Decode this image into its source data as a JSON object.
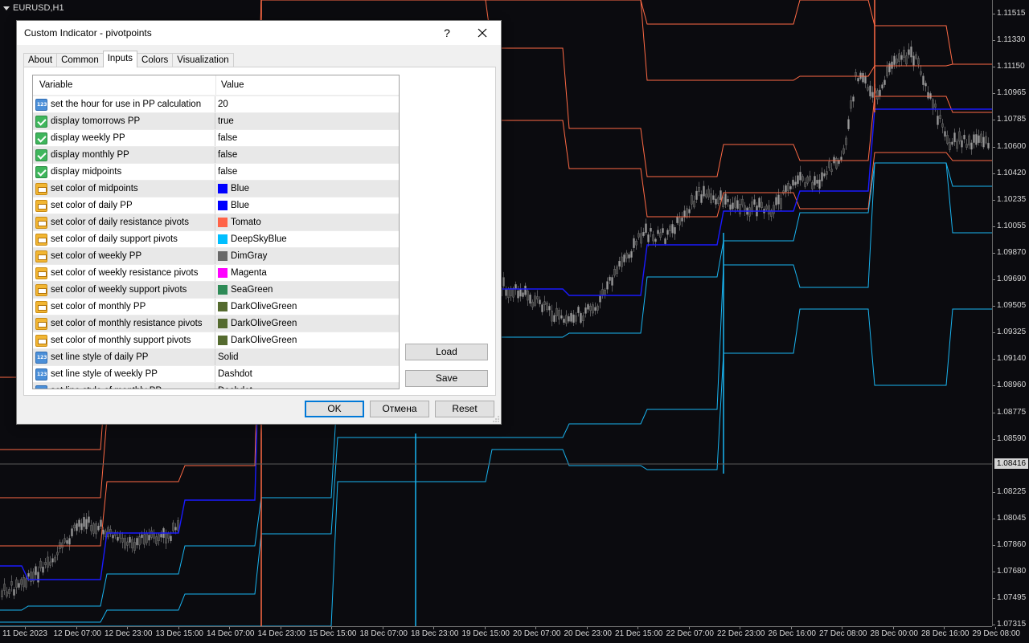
{
  "chart": {
    "symbol_label": "EURUSD,H1",
    "current_price": "1.08416",
    "price_labels": [
      "1.11515",
      "1.11330",
      "1.11150",
      "1.10965",
      "1.10785",
      "1.10600",
      "1.10420",
      "1.10235",
      "1.10055",
      "1.09870",
      "1.09690",
      "1.09505",
      "1.09325",
      "1.09140",
      "1.08960",
      "1.08775",
      "1.08590",
      "1.08416",
      "1.08225",
      "1.08045",
      "1.07860",
      "1.07680",
      "1.07495",
      "1.07315"
    ],
    "time_labels": [
      "11 Dec 2023",
      "12 Dec 07:00",
      "12 Dec 23:00",
      "13 Dec 15:00",
      "14 Dec 07:00",
      "14 Dec 23:00",
      "15 Dec 15:00",
      "18 Dec 07:00",
      "18 Dec 23:00",
      "19 Dec 15:00",
      "20 Dec 07:00",
      "20 Dec 23:00",
      "21 Dec 15:00",
      "22 Dec 07:00",
      "22 Dec 23:00",
      "26 Dec 16:00",
      "27 Dec 08:00",
      "28 Dec 00:00",
      "28 Dec 16:00",
      "29 Dec 08:00"
    ],
    "colors": {
      "background": "#0b0b0f",
      "resistance": "#ff6a45",
      "support": "#19b4f0",
      "pivot": "#1a1aff",
      "candle": "#8a8a8a"
    }
  },
  "dialog": {
    "title": "Custom Indicator - pivotpoints",
    "help_label": "?",
    "tabs": [
      "About",
      "Common",
      "Inputs",
      "Colors",
      "Visualization"
    ],
    "active_tab": "Inputs",
    "grid": {
      "col_variable": "Variable",
      "col_value": "Value",
      "rows": [
        {
          "type": "int",
          "variable": "set the hour for use in PP calculation",
          "value": "20"
        },
        {
          "type": "bool",
          "variable": "display tomorrows PP",
          "value": "true"
        },
        {
          "type": "bool",
          "variable": "display weekly PP",
          "value": "false"
        },
        {
          "type": "bool",
          "variable": "display monthly PP",
          "value": "false"
        },
        {
          "type": "bool",
          "variable": "display midpoints",
          "value": "false"
        },
        {
          "type": "color",
          "variable": "set color of midpoints",
          "value": "Blue",
          "swatch": "#0000ff"
        },
        {
          "type": "color",
          "variable": "set color of daily PP",
          "value": "Blue",
          "swatch": "#0000ff"
        },
        {
          "type": "color",
          "variable": "set color of daily resistance pivots",
          "value": "Tomato",
          "swatch": "#ff6347"
        },
        {
          "type": "color",
          "variable": "set color of daily support pivots",
          "value": "DeepSkyBlue",
          "swatch": "#00bfff"
        },
        {
          "type": "color",
          "variable": "set color of weekly PP",
          "value": "DimGray",
          "swatch": "#696969"
        },
        {
          "type": "color",
          "variable": "set color of weekly resistance pivots",
          "value": "Magenta",
          "swatch": "#ff00ff"
        },
        {
          "type": "color",
          "variable": "set color of weekly support pivots",
          "value": "SeaGreen",
          "swatch": "#2e8b57"
        },
        {
          "type": "color",
          "variable": "set color of monthly PP",
          "value": "DarkOliveGreen",
          "swatch": "#556b2f"
        },
        {
          "type": "color",
          "variable": "set color of monthly resistance pivots",
          "value": "DarkOliveGreen",
          "swatch": "#556b2f"
        },
        {
          "type": "color",
          "variable": "set color of monthly support pivots",
          "value": "DarkOliveGreen",
          "swatch": "#556b2f"
        },
        {
          "type": "int",
          "variable": "set line style of daily PP",
          "value": "Solid"
        },
        {
          "type": "int",
          "variable": "set line style of weekly PP",
          "value": "Dashdot"
        },
        {
          "type": "int",
          "variable": "set line style of monthly PP",
          "value": "Dashdot"
        }
      ]
    },
    "load_label": "Load",
    "save_label": "Save",
    "ok_label": "OK",
    "cancel_label": "Отмена",
    "reset_label": "Reset"
  }
}
